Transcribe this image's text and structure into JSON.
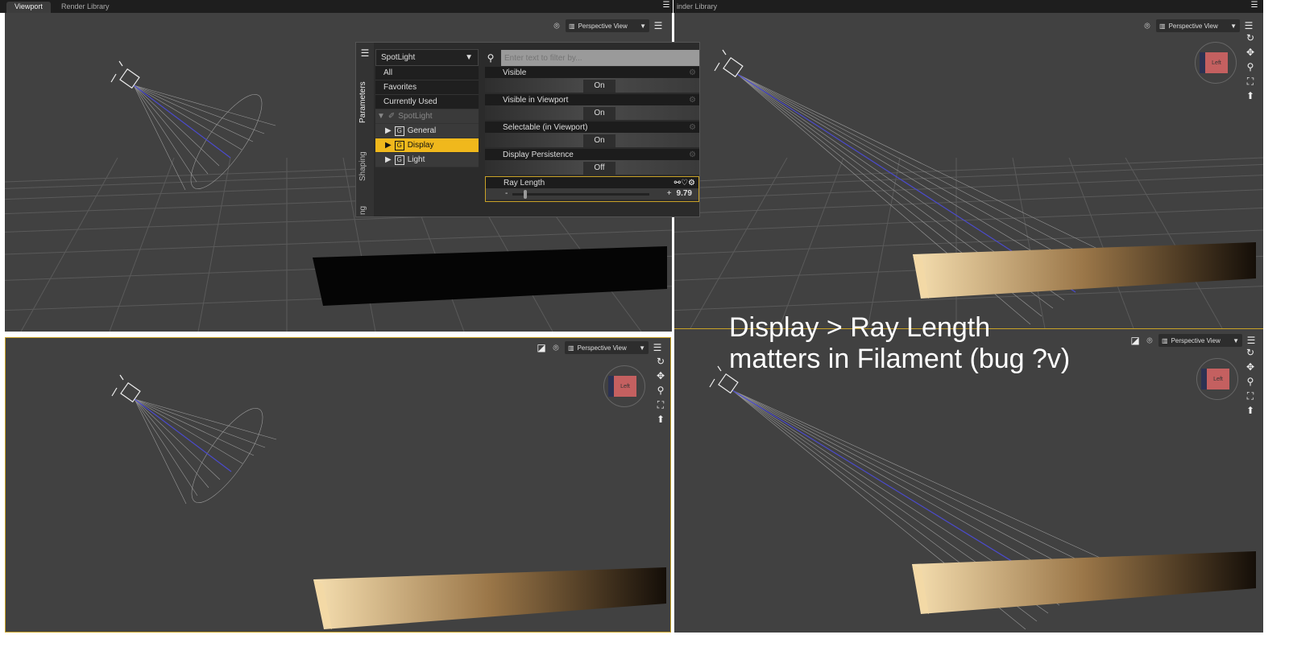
{
  "tabs": [
    {
      "label": "Viewport",
      "active": true
    },
    {
      "label": "Render Library",
      "active": false
    }
  ],
  "right_tab": "inder Library",
  "viewports": [
    {
      "id": "top-left",
      "view": "Perspective View"
    },
    {
      "id": "top-right",
      "view": "Perspective View",
      "cube_label": "Left"
    },
    {
      "id": "bottom-left",
      "view": "Perspective View",
      "cube_label": "Left"
    },
    {
      "id": "bottom-right",
      "view": "Perspective View",
      "cube_label": "Left"
    }
  ],
  "panel": {
    "side_tabs": [
      "Parameters",
      "Shaping",
      "ng"
    ],
    "node_select": "SpotLight",
    "filters": [
      "All",
      "Favorites",
      "Currently Used"
    ],
    "tree_root": "SpotLight",
    "groups": [
      {
        "label": "General",
        "selected": false
      },
      {
        "label": "Display",
        "selected": true
      },
      {
        "label": "Light",
        "selected": false
      }
    ],
    "filter_placeholder": "Enter text to filter by...",
    "properties": [
      {
        "label": "Visible",
        "value": "On"
      },
      {
        "label": "Visible in Viewport",
        "value": "On"
      },
      {
        "label": "Selectable (in Viewport)",
        "value": "On"
      },
      {
        "label": "Display Persistence",
        "value": "Off"
      }
    ],
    "ray_length": {
      "label": "Ray Length",
      "value": "9.79",
      "minus": "-",
      "plus": "+"
    }
  },
  "annotation": [
    "Display > Ray Length",
    "matters in Filament (bug ?v)"
  ],
  "colors": {
    "selection": "#f0b81c",
    "viewport_bg": "#414141"
  }
}
